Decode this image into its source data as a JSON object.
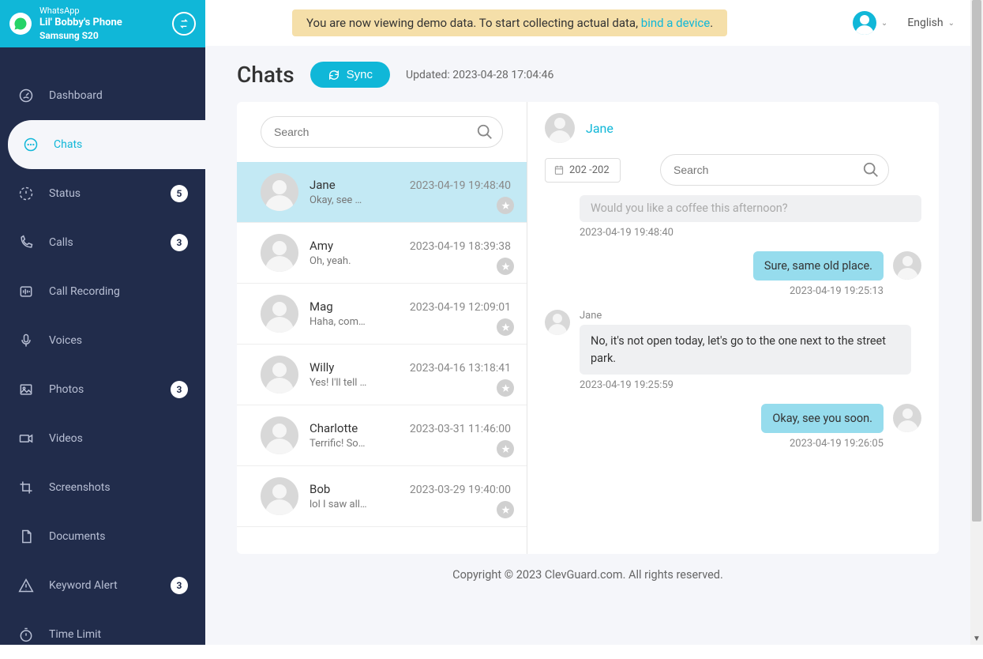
{
  "header": {
    "app": "WhatsApp",
    "device": "Lil' Bobby's Phone",
    "model": "Samsung S20"
  },
  "nav": {
    "dashboard": "Dashboard",
    "chats": "Chats",
    "status": "Status",
    "status_badge": "5",
    "calls": "Calls",
    "calls_badge": "3",
    "recording": "Call Recording",
    "voices": "Voices",
    "photos": "Photos",
    "photos_badge": "3",
    "videos": "Videos",
    "screenshots": "Screenshots",
    "documents": "Documents",
    "keyword": "Keyword Alert",
    "keyword_badge": "3",
    "timelimit": "Time Limit"
  },
  "banner": {
    "text1": "You are now viewing demo data. To start collecting actual data, ",
    "link": "bind a device",
    "text2": "."
  },
  "topbar": {
    "lang": "English"
  },
  "page": {
    "title": "Chats",
    "sync": "Sync",
    "updated": "Updated: 2023-04-28 17:04:46"
  },
  "search": {
    "placeholder": "Search"
  },
  "chat_list": [
    {
      "name": "Jane",
      "time": "2023-04-19 19:48:40",
      "preview": "Okay, see …"
    },
    {
      "name": "Amy",
      "time": "2023-04-19 18:39:38",
      "preview": "Oh, yeah."
    },
    {
      "name": "Mag",
      "time": "2023-04-19 12:09:01",
      "preview": "Haha, com…"
    },
    {
      "name": "Willy",
      "time": "2023-04-16 13:18:41",
      "preview": "Yes! I'll tell …"
    },
    {
      "name": "Charlotte",
      "time": "2023-03-31 11:46:00",
      "preview": "Terrific! So…"
    },
    {
      "name": "Bob",
      "time": "2023-03-29 19:40:00",
      "preview": "lol I saw all…"
    }
  ],
  "panel": {
    "name": "Jane",
    "date_range": "202 -202",
    "search_placeholder": "Search"
  },
  "messages": {
    "m0_text": "Would you like a coffee this afternoon?",
    "m0_time": "2023-04-19 19:48:40",
    "m1_text": "Sure, same old place.",
    "m1_time": "2023-04-19 19:25:13",
    "m2_sender": "Jane",
    "m2_text": "No, it's not open today, let's go to the one next to the street park.",
    "m2_time": "2023-04-19 19:25:59",
    "m3_text": "Okay, see you soon.",
    "m3_time": "2023-04-19 19:26:05"
  },
  "footer": "Copyright © 2023 ClevGuard.com. All rights reserved."
}
